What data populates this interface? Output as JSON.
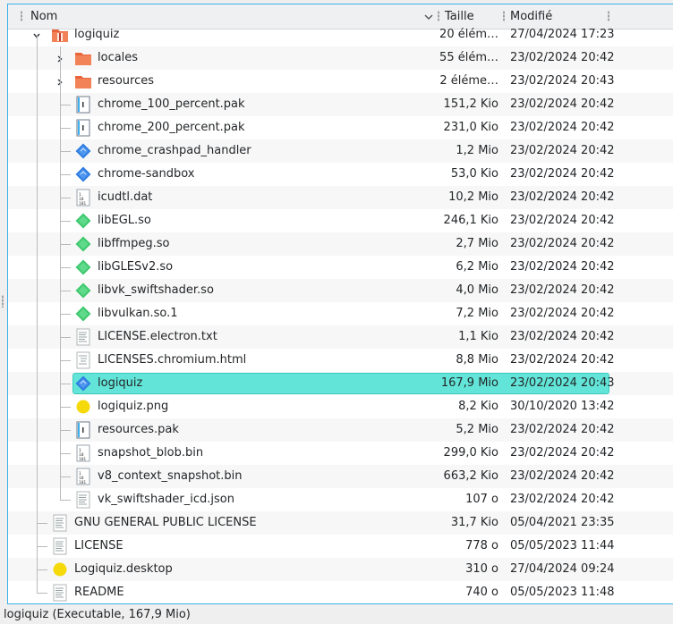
{
  "header": {
    "name_label": "Nom",
    "size_label": "Taille",
    "modified_label": "Modifié"
  },
  "rows": [
    {
      "name": "logiquiz",
      "size": "20 élém…",
      "date": "27/04/2024 17:23",
      "icon": "folder-archive-icon",
      "level": 1,
      "expander": "open"
    },
    {
      "name": "locales",
      "size": "55 élém…",
      "date": "23/02/2024 20:42",
      "icon": "folder-icon",
      "level": 2,
      "expander": "closed"
    },
    {
      "name": "resources",
      "size": "2 éléme…",
      "date": "23/02/2024 20:43",
      "icon": "folder-icon",
      "level": 2,
      "expander": "closed"
    },
    {
      "name": "chrome_100_percent.pak",
      "size": "151,2 Kio",
      "date": "23/02/2024 20:42",
      "icon": "binary-file-icon",
      "level": 2
    },
    {
      "name": "chrome_200_percent.pak",
      "size": "231,0 Kio",
      "date": "23/02/2024 20:42",
      "icon": "binary-file-icon",
      "level": 2
    },
    {
      "name": "chrome_crashpad_handler",
      "size": "1,2 Mio",
      "date": "23/02/2024 20:42",
      "icon": "executable-icon",
      "level": 2
    },
    {
      "name": "chrome-sandbox",
      "size": "53,0 Kio",
      "date": "23/02/2024 20:42",
      "icon": "executable-icon",
      "level": 2
    },
    {
      "name": "icudtl.dat",
      "size": "10,2 Mio",
      "date": "23/02/2024 20:42",
      "icon": "data-file-icon",
      "level": 2
    },
    {
      "name": "libEGL.so",
      "size": "246,1 Kio",
      "date": "23/02/2024 20:42",
      "icon": "shared-library-icon",
      "level": 2
    },
    {
      "name": "libffmpeg.so",
      "size": "2,7 Mio",
      "date": "23/02/2024 20:42",
      "icon": "shared-library-icon",
      "level": 2
    },
    {
      "name": "libGLESv2.so",
      "size": "6,2 Mio",
      "date": "23/02/2024 20:42",
      "icon": "shared-library-icon",
      "level": 2
    },
    {
      "name": "libvk_swiftshader.so",
      "size": "4,0 Mio",
      "date": "23/02/2024 20:42",
      "icon": "shared-library-icon",
      "level": 2
    },
    {
      "name": "libvulkan.so.1",
      "size": "7,2 Mio",
      "date": "23/02/2024 20:42",
      "icon": "shared-library-icon",
      "level": 2
    },
    {
      "name": "LICENSE.electron.txt",
      "size": "1,1 Kio",
      "date": "23/02/2024 20:42",
      "icon": "text-file-icon",
      "level": 2
    },
    {
      "name": "LICENSES.chromium.html",
      "size": "8,8 Mio",
      "date": "23/02/2024 20:42",
      "icon": "html-file-icon",
      "level": 2
    },
    {
      "name": "logiquiz",
      "size": "167,9 Mio",
      "date": "23/02/2024 20:43",
      "icon": "executable-icon",
      "level": 2,
      "selected": true
    },
    {
      "name": "logiquiz.png",
      "size": "8,2 Kio",
      "date": "30/10/2020 13:42",
      "icon": "image-icon",
      "level": 2
    },
    {
      "name": "resources.pak",
      "size": "5,2 Mio",
      "date": "23/02/2024 20:42",
      "icon": "binary-file-icon",
      "level": 2
    },
    {
      "name": "snapshot_blob.bin",
      "size": "299,0 Kio",
      "date": "23/02/2024 20:42",
      "icon": "data-file-icon",
      "level": 2
    },
    {
      "name": "v8_context_snapshot.bin",
      "size": "663,2 Kio",
      "date": "23/02/2024 20:42",
      "icon": "data-file-icon",
      "level": 2
    },
    {
      "name": "vk_swiftshader_icd.json",
      "size": "107 o",
      "date": "23/02/2024 20:42",
      "icon": "text-file-icon",
      "level": 2
    },
    {
      "name": "GNU GENERAL PUBLIC LICENSE",
      "size": "31,7 Kio",
      "date": "05/04/2021 23:35",
      "icon": "text-file-icon",
      "level": 1
    },
    {
      "name": "LICENSE",
      "size": "778 o",
      "date": "05/05/2023 11:44",
      "icon": "text-file-icon",
      "level": 1
    },
    {
      "name": "Logiquiz.desktop",
      "size": "310 o",
      "date": "27/04/2024 09:24",
      "icon": "image-icon",
      "level": 1
    },
    {
      "name": "README",
      "size": "740 o",
      "date": "05/05/2023 11:48",
      "icon": "text-file-icon",
      "level": 1
    }
  ],
  "status": {
    "text": "logiquiz (Executable, 167,9 Mio)"
  },
  "colors": {
    "selection": "#62e5d8",
    "accent_border": "#3daee9",
    "folder_orange": "#e9643a",
    "executable_blue": "#2f7de1",
    "library_green": "#3ec86e",
    "image_yellow": "#f5d90a"
  }
}
